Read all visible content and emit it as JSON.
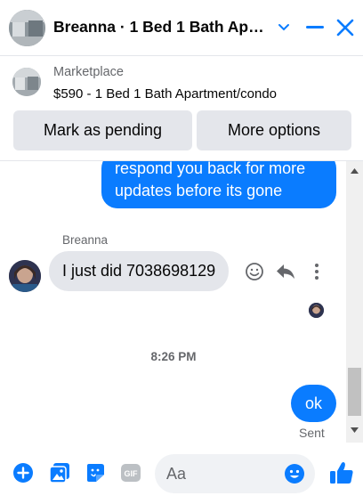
{
  "header": {
    "title": "Breanna · 1 Bed 1 Bath Apartment/condo",
    "avatar_icon": "apartment-photo-avatar",
    "chevron_icon": "chevron-down-icon",
    "minimize_icon": "minimize-icon",
    "close_icon": "close-icon"
  },
  "marketplace": {
    "label": "Marketplace",
    "listing": "$590 - 1 Bed 1 Bath Apartment/condo",
    "mark_pending_label": "Mark as pending",
    "more_options_label": "More options"
  },
  "messages": {
    "outgoing_partial": "respond you back for more updates before its gone",
    "sender_name": "Breanna",
    "incoming_text": "I just did 7038698129",
    "timestamp": "8:26 PM",
    "outgoing_ok": "ok",
    "status": "Sent"
  },
  "composer": {
    "placeholder": "Aa",
    "icons": [
      "plus-icon",
      "photo-icon",
      "sticker-icon",
      "gif-icon",
      "emoji-icon",
      "thumbs-up-icon"
    ]
  },
  "colors": {
    "accent": "#0a7cff",
    "bubble_gray": "#e4e6eb",
    "secondary_text": "#65676b"
  }
}
